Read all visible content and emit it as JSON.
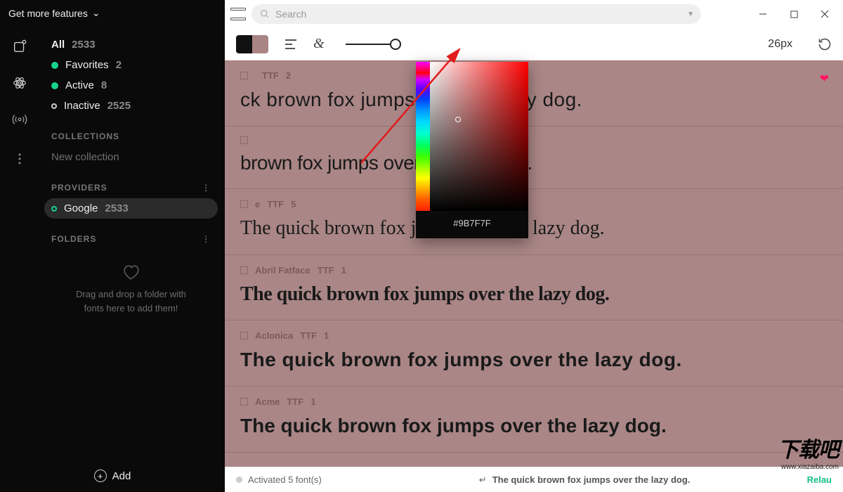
{
  "header": {
    "more_features": "Get more features"
  },
  "sidebar": {
    "all_label": "All",
    "all_count": "2533",
    "fav_label": "Favorites",
    "fav_count": "2",
    "active_label": "Active",
    "active_count": "8",
    "inactive_label": "Inactive",
    "inactive_count": "2525",
    "collections_head": "COLLECTIONS",
    "new_collection": "New collection",
    "providers_head": "PROVIDERS",
    "google_label": "Google",
    "google_count": "2533",
    "folders_head": "FOLDERS",
    "dropzone": "Drag and drop a folder with fonts here to add them!",
    "add_label": "Add"
  },
  "search": {
    "placeholder": "Search"
  },
  "toolbar": {
    "swatch_left": "#111111",
    "swatch_right": "#a88484",
    "size_value": "26px"
  },
  "color_picker": {
    "hex": "#9B7F7F"
  },
  "fonts": [
    {
      "name": "",
      "format": "TTF",
      "count": "2",
      "sample": "ck brown fox jumps over the lazy dog.",
      "favorite": true,
      "family": "sans-rounded"
    },
    {
      "name": "",
      "format": "",
      "count": "",
      "sample": "brown fox jumps over the lazy dog.",
      "favorite": false,
      "family": "sans-cond"
    },
    {
      "name": "e",
      "format": "TTF",
      "count": "5",
      "sample": "The quick brown fox jumps over the lazy dog.",
      "favorite": false,
      "family": "serif"
    },
    {
      "name": "Abril Fatface",
      "format": "TTF",
      "count": "1",
      "sample": "The quick brown fox jumps over the lazy dog.",
      "favorite": false,
      "family": "fat-serif"
    },
    {
      "name": "Aclonica",
      "format": "TTF",
      "count": "1",
      "sample": "The quick brown fox jumps over the lazy dog.",
      "favorite": false,
      "family": "flared"
    },
    {
      "name": "Acme",
      "format": "TTF",
      "count": "1",
      "sample": "The quick brown fox jumps over the lazy dog.",
      "favorite": false,
      "family": "semi-cond"
    }
  ],
  "status": {
    "activated": "Activated 5 font(s)",
    "sample_text": "The quick brown fox jumps over the lazy dog.",
    "relaunch": "Relau"
  },
  "watermark": {
    "big": "下载吧",
    "url": "www.xiazaiba.com"
  }
}
